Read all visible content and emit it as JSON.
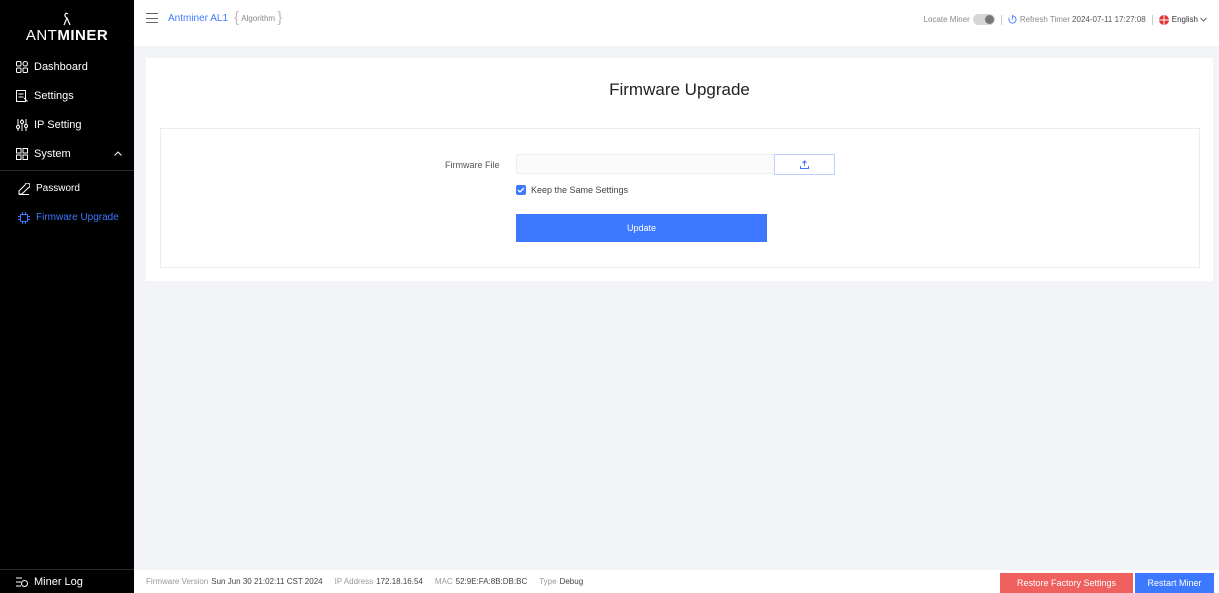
{
  "brand": {
    "logo_text_a": "ANT",
    "logo_text_b": "MINER"
  },
  "sidebar": {
    "items": [
      {
        "label": "Dashboard",
        "icon": "dashboard-icon"
      },
      {
        "label": "Settings",
        "icon": "settings-icon"
      },
      {
        "label": "IP Setting",
        "icon": "ip-setting-icon"
      },
      {
        "label": "System",
        "icon": "system-icon"
      }
    ],
    "sub_items": [
      {
        "label": "Password",
        "icon": "password-icon"
      },
      {
        "label": "Firmware Upgrade",
        "icon": "chip-icon",
        "active": true
      }
    ],
    "miner_log": "Miner Log"
  },
  "header": {
    "model": "Antminer AL1",
    "algorithm": "Algorithm",
    "locate_label": "Locate Miner",
    "refresh_label": "Refresh Timer",
    "refresh_time": "2024-07-11 17:27:08",
    "language": "English"
  },
  "main": {
    "title": "Firmware Upgrade",
    "file_label": "Firmware File",
    "file_value": "",
    "keep_settings_label": "Keep the Same Settings",
    "keep_settings_checked": true,
    "update_label": "Update"
  },
  "footer": {
    "firmware_label": "Firmware Version",
    "firmware_value": "Sun Jun 30 21:02:11 CST 2024",
    "ip_label": "IP Address",
    "ip_value": "172.18.16.54",
    "mac_label": "MAC",
    "mac_value": "52:9E:FA:8B:DB:BC",
    "type_label": "Type",
    "type_value": "Debug",
    "restore_label": "Restore Factory Settings",
    "restart_label": "Restart Miner"
  },
  "colors": {
    "accent": "#3d79ff",
    "danger": "#f0605f",
    "sidebar_bg": "#000000"
  }
}
